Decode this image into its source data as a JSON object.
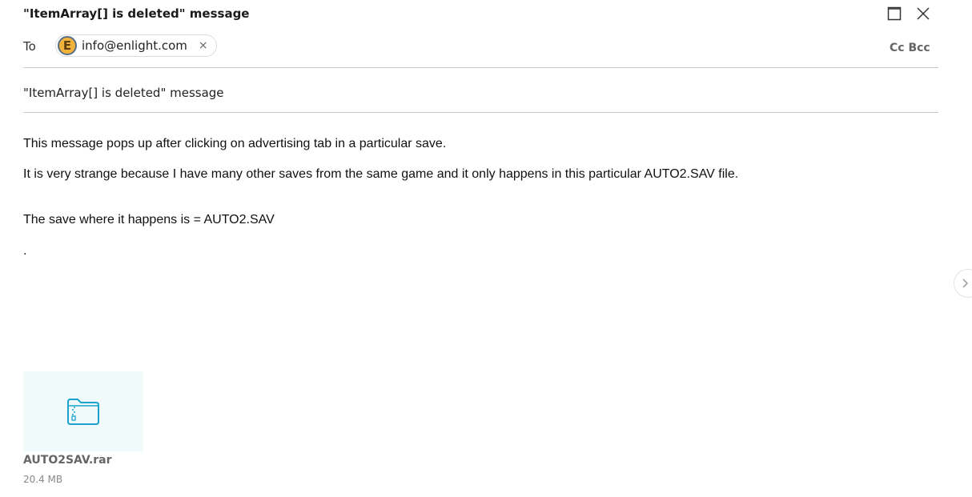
{
  "window": {
    "title": "\"ItemArray[] is deleted\" message"
  },
  "recipients": {
    "to_label": "To",
    "chips": [
      {
        "avatar_letter": "E",
        "email": "info@enlight.com",
        "remove": "×"
      }
    ],
    "cc_bcc": "Cc Bcc"
  },
  "subject": "\"ItemArray[] is deleted\" message",
  "body": {
    "lines": [
      "This message pops up after clicking on advertising tab in a particular save.",
      "It is very strange because I have many other saves from the same game and it only happens in this particular AUTO2.SAV file.",
      "The save where it happens is = AUTO2.SAV",
      "."
    ]
  },
  "attachment": {
    "name": "AUTO2SAV.rar",
    "size": "20.4 MB",
    "icon": "zip-folder-icon"
  },
  "colors": {
    "avatar_bg": "#f2b33d",
    "attachment_bg": "#f1fafa",
    "folder_icon": "#1aa3cc"
  }
}
